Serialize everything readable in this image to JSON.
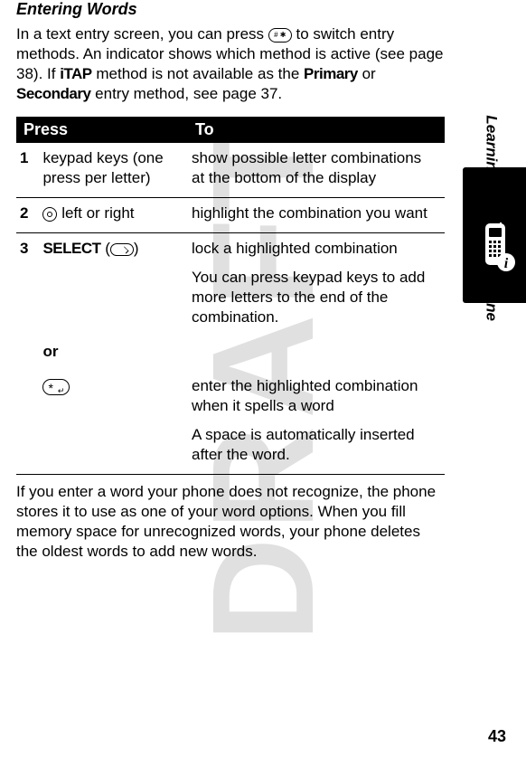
{
  "watermark": "DRAFT",
  "section_title": "Entering Words",
  "intro": {
    "part1": "In a text entry screen, you can press ",
    "part2": " to switch entry methods. An indicator shows which method is active (see page 38). If ",
    "itap": "iTAP",
    "part3": " method is not available as the ",
    "primary": "Primary",
    "part4": " or ",
    "secondary": "Secondary",
    "part5": " entry method, see page 37."
  },
  "table": {
    "head_press": "Press",
    "head_to": "To",
    "r1": {
      "num": "1",
      "press": "keypad keys (one press per letter)",
      "to": "show possible letter combinations at the bottom of the display"
    },
    "r2": {
      "num": "2",
      "press": " left or right",
      "to": " highlight the combination you want"
    },
    "r3": {
      "num": "3",
      "select": "SELECT",
      "to_a": "lock a highlighted combination",
      "to_b": "You can press keypad keys to add more letters to the end of the combination."
    },
    "or": "or",
    "r3b": {
      "to_a": "enter the highlighted combination when it spells a word",
      "to_b": "A space is automatically inserted after the word."
    }
  },
  "after_text": "If you enter a word your phone does not recognize, the phone stores it to use as one of your word options. When you fill memory space for unrecognized words, your phone deletes the oldest words to add new words.",
  "side_label": "Learning to Use Your Phone",
  "page_number": "43",
  "hash_key_glyph": "# ✱"
}
